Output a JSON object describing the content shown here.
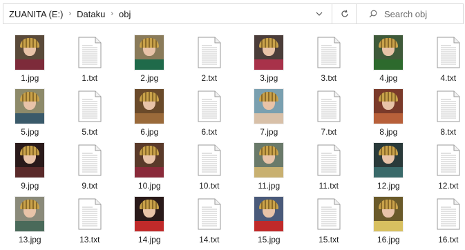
{
  "path": {
    "drive": "ZUANITA (E:)",
    "folder1": "Dataku",
    "folder2": "obj"
  },
  "search": {
    "placeholder": "Search obj"
  },
  "icons": {
    "separator": "chevron-right-icon",
    "dropdown": "chevron-down-icon",
    "refresh": "refresh-icon",
    "search": "search-icon",
    "text_file": "text-file-icon",
    "image_thumbnail": "image-thumbnail"
  },
  "files": [
    {
      "name": "1.jpg",
      "type": "image",
      "bg": "#5a4a3a",
      "dress": "#7d2b3a"
    },
    {
      "name": "1.txt",
      "type": "text"
    },
    {
      "name": "2.jpg",
      "type": "image",
      "bg": "#8a7b5a",
      "dress": "#1f6a4a"
    },
    {
      "name": "2.txt",
      "type": "text"
    },
    {
      "name": "3.jpg",
      "type": "image",
      "bg": "#4b3d3a",
      "dress": "#a8324a"
    },
    {
      "name": "3.txt",
      "type": "text"
    },
    {
      "name": "4.jpg",
      "type": "image",
      "bg": "#3f5a3a",
      "dress": "#2d6a2d"
    },
    {
      "name": "4.txt",
      "type": "text"
    },
    {
      "name": "5.jpg",
      "type": "image",
      "bg": "#8d8a6a",
      "dress": "#3a5a6a"
    },
    {
      "name": "5.txt",
      "type": "text"
    },
    {
      "name": "6.jpg",
      "type": "image",
      "bg": "#6a4a2a",
      "dress": "#9a6a3a"
    },
    {
      "name": "6.txt",
      "type": "text"
    },
    {
      "name": "7.jpg",
      "type": "image",
      "bg": "#7aa0b0",
      "dress": "#d8c0a8"
    },
    {
      "name": "7.txt",
      "type": "text"
    },
    {
      "name": "8.jpg",
      "type": "image",
      "bg": "#7a3a2a",
      "dress": "#b8603a"
    },
    {
      "name": "8.txt",
      "type": "text"
    },
    {
      "name": "9.jpg",
      "type": "image",
      "bg": "#2a1a1a",
      "dress": "#5a2a2a"
    },
    {
      "name": "9.txt",
      "type": "text"
    },
    {
      "name": "10.jpg",
      "type": "image",
      "bg": "#5a3a2a",
      "dress": "#8a2a3a"
    },
    {
      "name": "10.txt",
      "type": "text"
    },
    {
      "name": "11.jpg",
      "type": "image",
      "bg": "#6a7a6a",
      "dress": "#c8b070"
    },
    {
      "name": "11.txt",
      "type": "text"
    },
    {
      "name": "12.jpg",
      "type": "image",
      "bg": "#2a3a3a",
      "dress": "#3a6a6a"
    },
    {
      "name": "12.txt",
      "type": "text"
    },
    {
      "name": "13.jpg",
      "type": "image",
      "bg": "#8a8a7a",
      "dress": "#4a6a5a"
    },
    {
      "name": "13.txt",
      "type": "text"
    },
    {
      "name": "14.jpg",
      "type": "image",
      "bg": "#2a1a1a",
      "dress": "#c02a2a"
    },
    {
      "name": "14.txt",
      "type": "text"
    },
    {
      "name": "15.jpg",
      "type": "image",
      "bg": "#4a5a7a",
      "dress": "#c02a2a"
    },
    {
      "name": "15.txt",
      "type": "text"
    },
    {
      "name": "16.jpg",
      "type": "image",
      "bg": "#6a5a2a",
      "dress": "#d8c060"
    },
    {
      "name": "16.txt",
      "type": "text"
    }
  ]
}
